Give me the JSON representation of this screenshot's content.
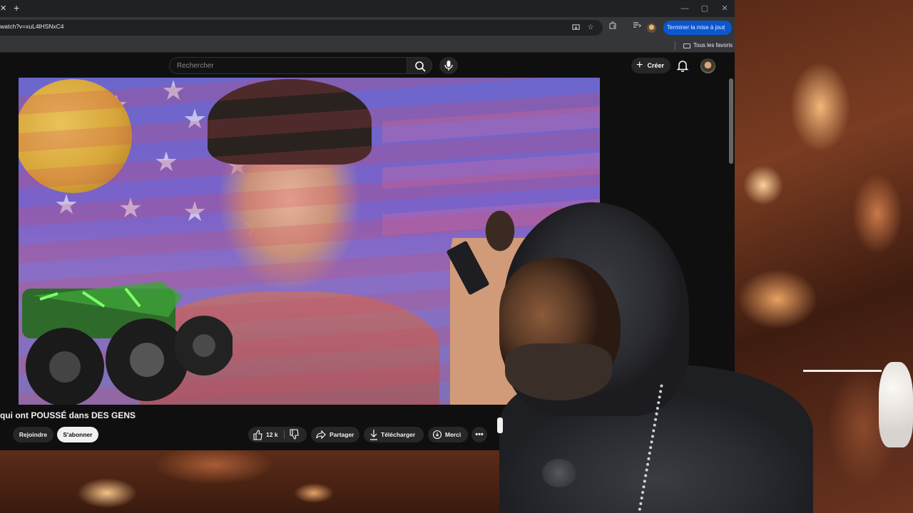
{
  "browser": {
    "url": "watch?v=xuL4lHSNxC4",
    "update_button": "Terminer la mise à jour",
    "bookmarks_folder": "Tous les favoris",
    "colors": {
      "tabstrip": "#202124",
      "toolbar": "#35363a",
      "update_blue": "#0b57d0"
    }
  },
  "youtube": {
    "search": {
      "placeholder": "Rechercher"
    },
    "create_label": "Créer",
    "video": {
      "title": "qui ont POUSSÉ dans DES GENS",
      "join_label": "Rejoindre",
      "subscribe_label": "S'abonner",
      "likes": "12 k",
      "share_label": "Partager",
      "download_label": "Télécharger",
      "thanks_label": "Merci"
    }
  }
}
